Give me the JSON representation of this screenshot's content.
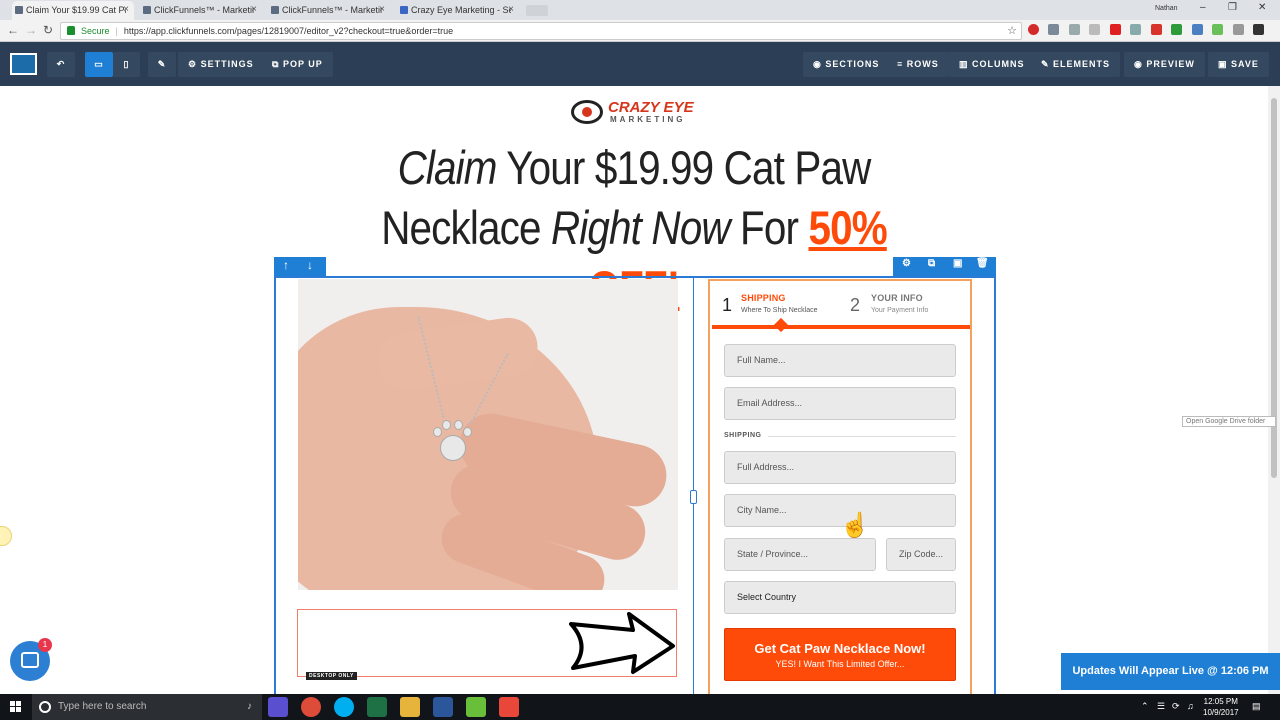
{
  "browser": {
    "tabs": [
      {
        "label": "Claim Your $19.99 Cat Pa",
        "active": true
      },
      {
        "label": "ClickFunnels™ - Marketin",
        "active": false
      },
      {
        "label": "ClickFunnels™ - Marketin",
        "active": false
      },
      {
        "label": "Crazy Eye Marketing - Se",
        "active": false
      }
    ],
    "profile": "Nathan",
    "secure_label": "Secure",
    "url": "https://app.clickfunnels.com/pages/12819007/editor_v2?checkout=true&order=true"
  },
  "editor": {
    "settings": "SETTINGS",
    "popup": "POP UP",
    "sections": "SECTIONS",
    "rows": "ROWS",
    "columns": "COLUMNS",
    "elements": "ELEMENTS",
    "preview": "PREVIEW",
    "save": "SAVE"
  },
  "page": {
    "brand_top": "CRAZY EYE",
    "brand_bottom": "MARKETING",
    "headline_l1_a": "Claim",
    "headline_l1_b": " Your $19.99 Cat Paw",
    "headline_l2_a": "Necklace ",
    "headline_l2_b": "Right Now",
    "headline_l2_c": " For ",
    "headline_l2_d": "50% OFF!",
    "desktop_only": "DESKTOP ONLY"
  },
  "form": {
    "step1_num": "1",
    "step1_title": "SHIPPING",
    "step1_sub": "Where To Ship Necklace",
    "step2_num": "2",
    "step2_title": "YOUR INFO",
    "step2_sub": "Your Payment Info",
    "full_name": "Full Name...",
    "email": "Email Address...",
    "shipping_label": "SHIPPING",
    "full_address": "Full Address...",
    "city": "City Name...",
    "state": "State / Province...",
    "zip": "Zip Code...",
    "country": "Select Country",
    "cta_main": "Get Cat Paw Necklace Now!",
    "cta_sub": "YES! I Want This Limited Offer..."
  },
  "overlay": {
    "tooltip": "Open Google Drive folder",
    "updates": "Updates Will Appear Live @ 12:06 PM",
    "chat_badge": "1"
  },
  "taskbar": {
    "search": "Type here to search",
    "time": "12:05 PM",
    "date": "10/9/2017"
  },
  "colors": {
    "accent": "#ff4b0a",
    "editor_bar": "#2b3e55",
    "editor_blue": "#1e7fd4"
  }
}
